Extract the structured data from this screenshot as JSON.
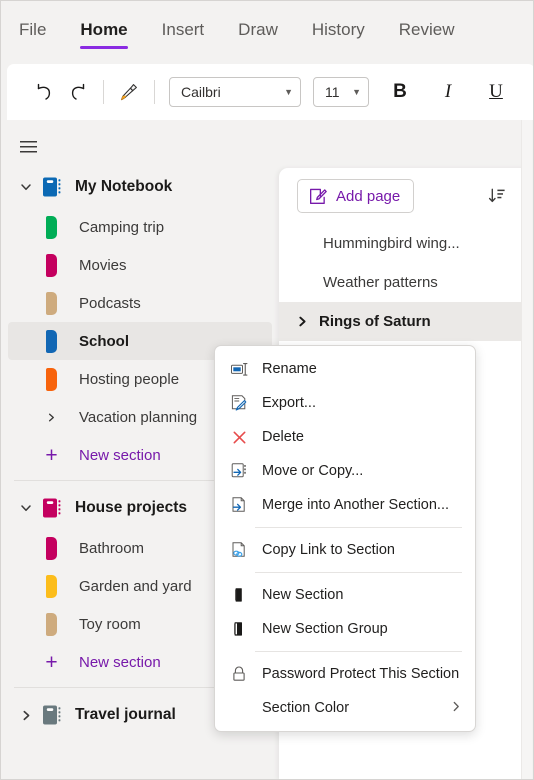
{
  "ribbon": {
    "tabs": [
      {
        "label": "File",
        "active": false
      },
      {
        "label": "Home",
        "active": true
      },
      {
        "label": "Insert",
        "active": false
      },
      {
        "label": "Draw",
        "active": false
      },
      {
        "label": "History",
        "active": false
      },
      {
        "label": "Review",
        "active": false
      }
    ],
    "active_tab_underline_color": "#8a2be2",
    "toolbar": {
      "undo_icon": "undo-arrow-icon",
      "redo_icon": "redo-arrow-icon",
      "format_painter_icon": "format-painter-icon",
      "font_name": "Cailbri",
      "font_size": "11",
      "bold_label": "B",
      "italic_label": "I",
      "underline_label": "U"
    }
  },
  "nav": {
    "hamburger_icon": "hamburger-menu-icon",
    "notebooks": [
      {
        "name": "My Notebook",
        "color": "#0b69b4",
        "expanded": true,
        "chevron": "chevron-down-icon",
        "sections": [
          {
            "name": "Camping trip",
            "color": "#00ad56",
            "type": "section",
            "selected": false
          },
          {
            "name": "Movies",
            "color": "#c4005f",
            "type": "section",
            "selected": false
          },
          {
            "name": "Podcasts",
            "color": "#ceab7e",
            "type": "section",
            "selected": false
          },
          {
            "name": "School",
            "color": "#1267b4",
            "type": "section",
            "selected": true
          },
          {
            "name": "Hosting people",
            "color": "#f7630c",
            "type": "section",
            "selected": false
          },
          {
            "name": "Vacation planning",
            "color": "",
            "type": "group",
            "selected": false
          }
        ],
        "new_section_label": "New section"
      },
      {
        "name": "House projects",
        "color": "#c4005f",
        "expanded": true,
        "chevron": "chevron-down-icon",
        "sections": [
          {
            "name": "Bathroom",
            "color": "#c4005f",
            "type": "section",
            "selected": false
          },
          {
            "name": "Garden and yard",
            "color": "#fcbd1b",
            "type": "section",
            "selected": false
          },
          {
            "name": "Toy room",
            "color": "#ceab7e",
            "type": "section",
            "selected": false
          }
        ],
        "new_section_label": "New section"
      },
      {
        "name": "Travel journal",
        "color": "#69797e",
        "expanded": false,
        "chevron": "chevron-right-icon",
        "sections": [],
        "new_section_label": ""
      }
    ],
    "accent_color": "#7719aa"
  },
  "pages": {
    "add_page_label": "Add page",
    "add_page_icon": "new-page-edit-icon",
    "sort_icon": "sort-descending-icon",
    "items": [
      {
        "title": "Hummingbird wing...",
        "selected": false,
        "expandable": false
      },
      {
        "title": "Weather patterns",
        "selected": false,
        "expandable": false
      },
      {
        "title": "Rings of Saturn",
        "selected": true,
        "expandable": true
      }
    ]
  },
  "context_menu": {
    "items": [
      {
        "label": "Rename",
        "icon": "rename-icon",
        "divider_after": false,
        "submenu": ""
      },
      {
        "label": "Export...",
        "icon": "export-icon",
        "divider_after": false,
        "submenu": ""
      },
      {
        "label": "Delete",
        "icon": "delete-x-icon",
        "divider_after": false,
        "submenu": ""
      },
      {
        "label": "Move or Copy...",
        "icon": "move-or-copy-icon",
        "divider_after": false,
        "submenu": ""
      },
      {
        "label": "Merge into Another Section...",
        "icon": "merge-section-icon",
        "divider_after": true,
        "submenu": ""
      },
      {
        "label": "Copy Link to Section",
        "icon": "copy-link-icon",
        "divider_after": true,
        "submenu": ""
      },
      {
        "label": "New Section",
        "icon": "new-section-icon",
        "divider_after": false,
        "submenu": ""
      },
      {
        "label": "New Section Group",
        "icon": "new-section-group-icon",
        "divider_after": true,
        "submenu": ""
      },
      {
        "label": "Password Protect This Section",
        "icon": "lock-icon",
        "divider_after": false,
        "submenu": ""
      },
      {
        "label": "Section Color",
        "icon": "",
        "divider_after": false,
        "submenu": "›"
      }
    ]
  }
}
